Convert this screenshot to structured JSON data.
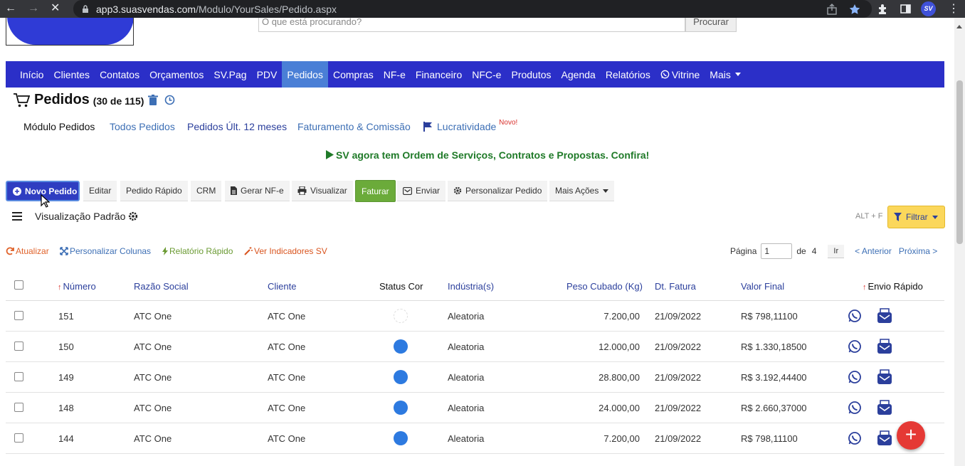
{
  "browser": {
    "url_host": "app3.suasvendas.com",
    "url_path": "/Modulo/YourSales/Pedido.aspx",
    "profile_initials": "SV",
    "back_glyph": "←",
    "forward_glyph": "→",
    "stop_glyph": "✕",
    "menu_glyph": "⋮"
  },
  "header": {
    "search_placeholder": "O que está procurando?",
    "search_button": "Procurar"
  },
  "mainnav": {
    "items": [
      "Início",
      "Clientes",
      "Contatos",
      "Orçamentos",
      "SV.Pag",
      "PDV",
      "Pedidos",
      "Compras",
      "NF-e",
      "Financeiro",
      "NFC-e",
      "Produtos",
      "Agenda",
      "Relatórios",
      "Vitrine",
      "Mais"
    ],
    "active": "Pedidos"
  },
  "page": {
    "title": "Pedidos",
    "count": "(30 de 115)"
  },
  "subtabs": {
    "modulo": "Módulo Pedidos",
    "todos": "Todos Pedidos",
    "ult12": "Pedidos Últ. 12 meses",
    "faturamento": "Faturamento & Comissão",
    "lucratividade": "Lucratividade",
    "new_badge": "Novo!"
  },
  "promo": "SV agora tem Ordem de Serviços, Contratos e Propostas. Confira!",
  "toolbar": {
    "novo_pedido": "Novo Pedido",
    "editar": "Editar",
    "pedido_rapido": "Pedido Rápido",
    "crm": "CRM",
    "gerar_nfe": "Gerar NF-e",
    "visualizar": "Visualizar",
    "faturar": "Faturar",
    "enviar": "Enviar",
    "personalizar": "Personalizar Pedido",
    "mais_acoes": "Mais Ações"
  },
  "view": {
    "label": "Visualização Padrão",
    "shortcut": "ALT + F",
    "filter": "Filtrar"
  },
  "actions": {
    "atualizar": "Atualizar",
    "colunas": "Personalizar Colunas",
    "relatorio": "Relatório Rápido",
    "indicadores": "Ver Indicadores SV"
  },
  "pagination": {
    "label": "Página",
    "current": "1",
    "of": "de",
    "total": "4",
    "go": "Ir",
    "prev": "< Anterior",
    "next": "Próxima >"
  },
  "table": {
    "columns": {
      "numero": "Número",
      "razao": "Razão Social",
      "cliente": "Cliente",
      "status": "Status Cor",
      "industria": "Indústria(s)",
      "peso": "Peso Cubado (Kg)",
      "data": "Dt. Fatura",
      "valor": "Valor Final",
      "envio": "Envio Rápido"
    },
    "rows": [
      {
        "numero": "151",
        "razao": "ATC One",
        "cliente": "ATC One",
        "status": "none",
        "industria": "Aleatoria",
        "peso": "7.200,00",
        "data": "21/09/2022",
        "valor": "R$ 798,11100"
      },
      {
        "numero": "150",
        "razao": "ATC One",
        "cliente": "ATC One",
        "status": "blue",
        "industria": "Aleatoria",
        "peso": "12.000,00",
        "data": "21/09/2022",
        "valor": "R$ 1.330,18500"
      },
      {
        "numero": "149",
        "razao": "ATC One",
        "cliente": "ATC One",
        "status": "blue",
        "industria": "Aleatoria",
        "peso": "28.800,00",
        "data": "21/09/2022",
        "valor": "R$ 3.192,44400"
      },
      {
        "numero": "148",
        "razao": "ATC One",
        "cliente": "ATC One",
        "status": "blue",
        "industria": "Aleatoria",
        "peso": "24.000,00",
        "data": "21/09/2022",
        "valor": "R$ 2.660,37000"
      },
      {
        "numero": "144",
        "razao": "ATC One",
        "cliente": "ATC One",
        "status": "blue",
        "industria": "Aleatoria",
        "peso": "7.200,00",
        "data": "21/09/2022",
        "valor": "R$ 798,11100"
      }
    ]
  },
  "fab_glyph": "+",
  "colors": {
    "nav_bg": "#2b2fc8",
    "nav_active": "#4a7fd6",
    "link_blue": "#3d6fb5",
    "status_blue": "#2d7ae0",
    "filter_yellow": "#fbd75b",
    "faturar_green": "#6bab3a",
    "fab_red": "#e53935"
  },
  "icons": [
    "back-icon",
    "forward-icon",
    "stop-icon",
    "lock-icon",
    "share-icon",
    "bookmark-star-icon",
    "extensions-icon",
    "sidepanel-icon",
    "cart-icon",
    "trash-icon",
    "history-icon",
    "flag-icon",
    "play-icon",
    "plus-circle-icon",
    "file-icon",
    "print-icon",
    "envelope-icon",
    "gear-icon",
    "hamburger-icon",
    "filter-icon",
    "refresh-icon",
    "expand-icon",
    "bolt-icon",
    "magic-icon",
    "whatsapp-icon",
    "email-box-icon"
  ]
}
